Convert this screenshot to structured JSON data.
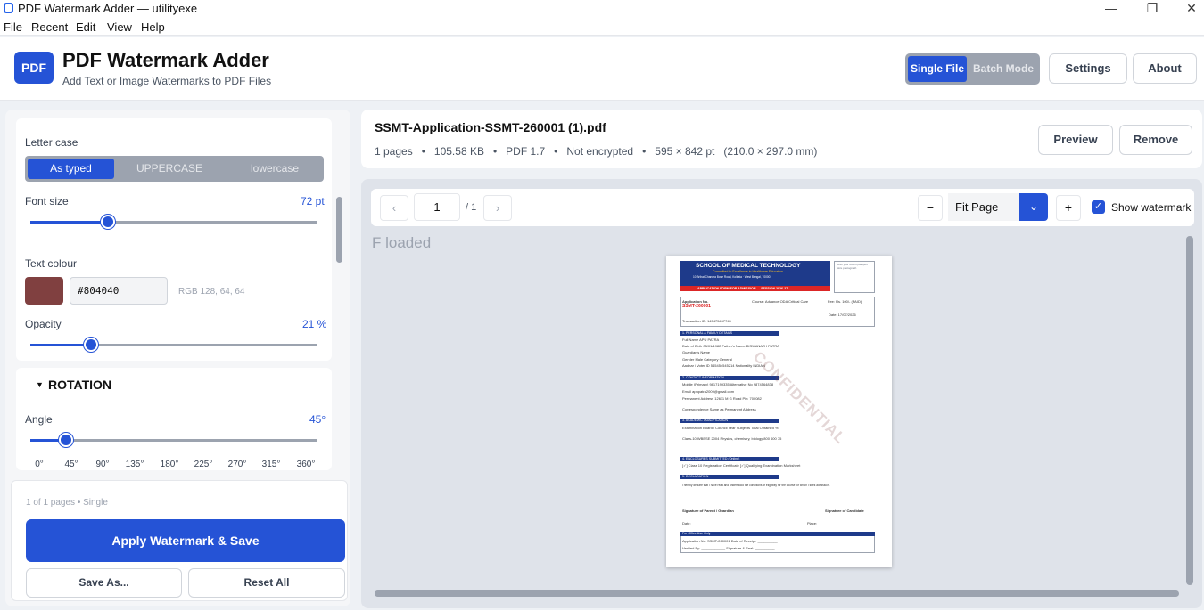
{
  "window": {
    "title": "PDF Watermark Adder  —  utilityexe",
    "minimize": "—",
    "maximize": "❐",
    "close": "✕"
  },
  "menu": [
    "File",
    "Recent",
    "Edit",
    "View",
    "Help"
  ],
  "header": {
    "logo": "PDF",
    "title": "PDF Watermark Adder",
    "subtitle": "Add Text or Image Watermarks to PDF Files",
    "mode_single": "Single File",
    "mode_batch": "Batch Mode",
    "settings": "Settings",
    "about": "About"
  },
  "left": {
    "letter_case_label": "Letter case",
    "case_options": [
      "As typed",
      "UPPERCASE",
      "lowercase"
    ],
    "case_selected": "As typed",
    "font_size_label": "Font size",
    "font_size_value": "72 pt",
    "font_size_fraction": 0.27,
    "text_colour_label": "Text colour",
    "colour_hex": "#804040",
    "colour_rgb": "RGB 128, 64, 64",
    "opacity_label": "Opacity",
    "opacity_value": "21 %",
    "opacity_fraction": 0.21,
    "rotation_title": "ROTATION",
    "angle_label": "Angle",
    "angle_value": "45°",
    "angle_fraction": 0.125,
    "angle_presets": [
      "0°",
      "45°",
      "90°",
      "135°",
      "180°",
      "225°",
      "270°",
      "315°",
      "360°"
    ]
  },
  "actions": {
    "page_info": "1 of 1 pages • Single",
    "apply": "Apply Watermark & Save",
    "save_as": "Save As...",
    "reset": "Reset All"
  },
  "file": {
    "name": "SSMT-Application-SSMT-260001 (1).pdf",
    "meta": "1 pages   •   105.58 KB   •   PDF 1.7   •   Not encrypted   •   595 × 842 pt   (210.0 × 297.0 mm)",
    "preview": "Preview",
    "remove": "Remove"
  },
  "viewer": {
    "prev": "‹",
    "next": "›",
    "page": "1",
    "total": "/ 1",
    "zoom_out": "−",
    "zoom": "Fit Page",
    "zoom_in": "+",
    "show_watermark": "Show watermark",
    "show_watermark_checked": true,
    "loaded_text": "F loaded"
  },
  "document": {
    "school": "SCHOOL OF MEDICAL TECHNOLOGY",
    "tagline": "Committed to Excellence in Healthcare Education",
    "address": "10 Brihat Chandra Bose Road, Kolkata · West Bengal, 700001",
    "form_title": "APPLICATION FORM FOR ADMISSION — SESSION 2026-27",
    "photo": "Affix your recent passport size photograph",
    "app_no_label": "Application No.",
    "app_no": "SSMT-260001",
    "course": "Course: Advance ODA Critical Care",
    "fee": "Fee: Rs. 100/- (PAID)",
    "date": "Date: 17/07/2026",
    "txn": "Transaction ID: 145475457745",
    "sec1": "1. PERSONAL & FAMILY DETAILS",
    "sec2": "2. CONTACT INFORMATION",
    "sec3": "3. ACADEMIC QUALIFICATION",
    "sec4": "4. ENCLOSURES SUBMITTED (Online)",
    "sec5": "5. DECLARATION",
    "rows1": [
      "Full Name   APU PATRA",
      "Date of Birth   05/01/1982        Father's Name   BISWANATH PATRA",
      "Guardian's Name",
      "Gender   Male        Category   General",
      "Aadhar / Voter ID   545454545214        Nationality   INDIAN"
    ],
    "rows2": [
      "Mobile (Primary)   9817199335        Alternative No   9874564838",
      "Email   apupatra2009@gmail.com",
      "Permanent Address   12611 M G Road Pin: 700082",
      "Correspondence   Same as Permanent Address"
    ],
    "rows3": [
      "Examination   Board / Council   Year   Subjects   Total   Obtained   %",
      "Class-10   WBBSE   2004   Physics, chemistry, biology   800   600   75"
    ],
    "rows4": [
      "[✓] Class 10 Registration Certificate        [✓] Qualifying Examination Marksheet"
    ],
    "decl": "I hereby declare that I have read and understood the conditions of eligibility for the course for which I seek admission.",
    "sig_parent": "Signature of Parent / Guardian",
    "sig_cand": "Signature of Candidate",
    "date_lbl": "Date: ____________",
    "place_lbl": "Place: ____________",
    "office": "For Office Use Only",
    "office_rows": [
      "Application No: SSMT-260001        Date of Receipt: __________",
      "Verified By: ____________        Signature & Seal: __________"
    ],
    "watermark": "CONFIDENTIAL"
  },
  "colors": {
    "accent": "#2553d6",
    "watermark": "#804040"
  }
}
